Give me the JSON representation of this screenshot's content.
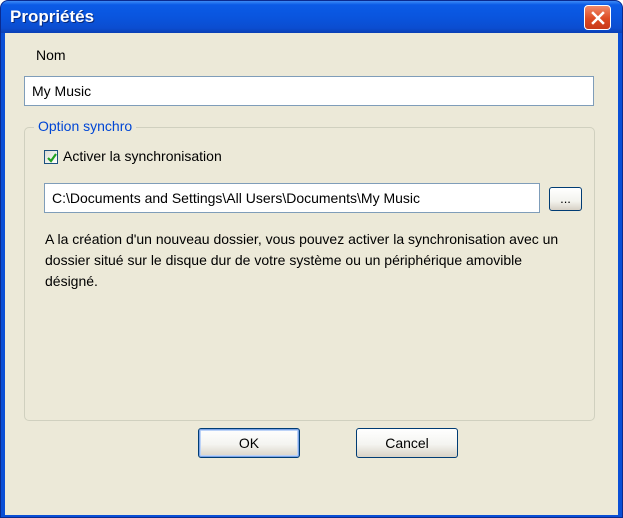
{
  "window": {
    "title": "Propriétés",
    "close_label": "×"
  },
  "name_section": {
    "label": "Nom",
    "value": "My Music"
  },
  "sync_group": {
    "legend": "Option synchro",
    "checkbox_label": "Activer la synchronisation",
    "checkbox_checked": true,
    "path_value": "C:\\Documents and Settings\\All Users\\Documents\\My Music",
    "browse_label": "...",
    "description": "A la création d'un nouveau dossier, vous pouvez activer la synchronisation avec un dossier situé sur le disque dur de votre système ou un périphérique amovible désigné."
  },
  "buttons": {
    "ok_label": "OK",
    "cancel_label": "Cancel"
  },
  "icons": {
    "close": "close-icon",
    "check": "checkmark-icon"
  },
  "colors": {
    "titlebar": "#0a55de",
    "dialog_bg": "#ece9d8",
    "close_button": "#dd4a23",
    "group_legend": "#0046d5",
    "check_mark": "#21a121"
  }
}
